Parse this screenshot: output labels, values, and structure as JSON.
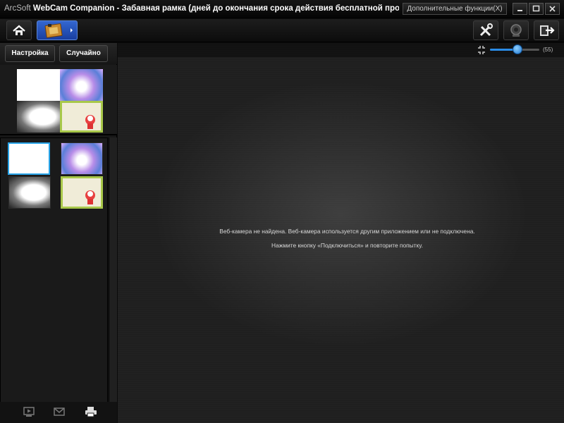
{
  "window": {
    "brand": "ArcSoft",
    "product": "WebCam Companion",
    "title_rest": " - Забавная рамка (дней до окончания срока действия бесплатной пробной верс...",
    "extra_functions": "Дополнительные функции(X)"
  },
  "toolbar": {
    "home_icon": "home-icon",
    "frame_icon": "fun-frame-icon",
    "tools_icon": "tools-icon",
    "webcam_icon": "webcam-icon",
    "exit_icon": "exit-icon"
  },
  "sidebar": {
    "tab_settings": "Настройка",
    "tab_random": "Случайно"
  },
  "zoom": {
    "value_label": "(55)",
    "level": 0.55
  },
  "main": {
    "message_1": "Веб-камера не найдена. Веб-камера используется другим приложением или не подключена.",
    "message_2": "Нажмите кнопку «Подключиться» и повторите попытку."
  },
  "colors": {
    "accent": "#2a8be6",
    "selection": "#28a4e8",
    "toolbar_active": "#2a56c0"
  }
}
